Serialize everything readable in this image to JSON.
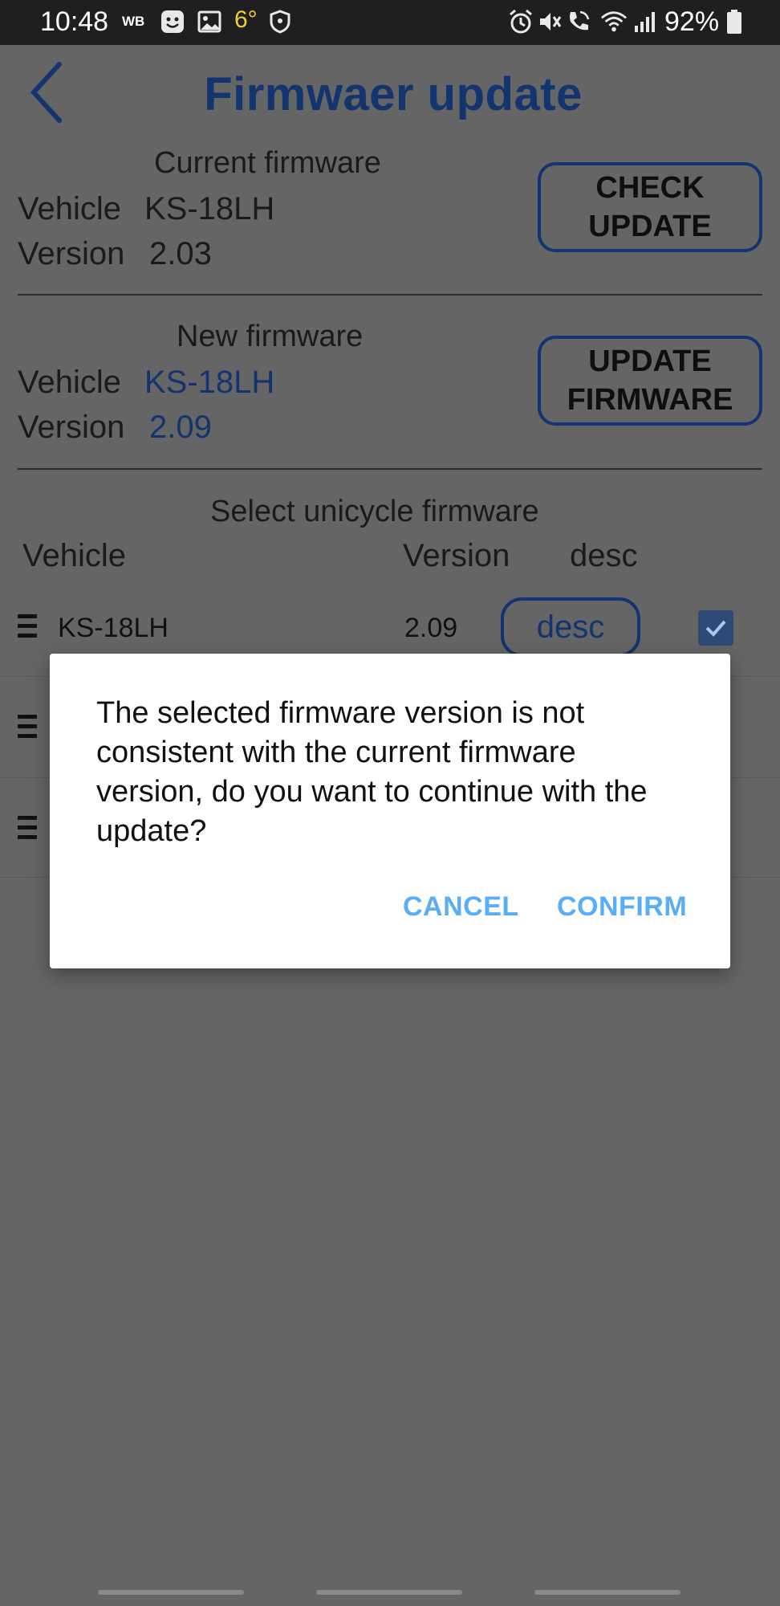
{
  "status_bar": {
    "time": "10:48",
    "carrier_badge": "WB",
    "temperature": "6°",
    "battery_percent": "92%",
    "icons": [
      "smiley-icon",
      "image-icon",
      "shield-icon",
      "alarm-icon",
      "mute-icon",
      "wifi-call-icon",
      "wifi-icon",
      "signal-icon",
      "battery-icon"
    ]
  },
  "header": {
    "title": "Firmwaer update",
    "back_icon": "chevron-left-icon"
  },
  "current_firmware": {
    "heading": "Current firmware",
    "vehicle_label": "Vehicle",
    "vehicle_value": "KS-18LH",
    "version_label": "Version",
    "version_value": "2.03",
    "button_line1": "CHECK",
    "button_line2": "UPDATE"
  },
  "new_firmware": {
    "heading": "New firmware",
    "vehicle_label": "Vehicle",
    "vehicle_value": "KS-18LH",
    "version_label": "Version",
    "version_value": "2.09",
    "button_line1": "UPDATE",
    "button_line2": "FIRMWARE"
  },
  "select_section": {
    "heading": "Select unicycle firmware",
    "columns": [
      "Vehicle",
      "Version",
      "desc"
    ],
    "rows": [
      {
        "vehicle": "KS-18LH",
        "version": "2.09",
        "desc_label": "desc",
        "checked": true
      }
    ]
  },
  "dialog": {
    "message": "The selected firmware version is not consistent with the current firmware version, do you want to continue with the update?",
    "cancel_label": "CANCEL",
    "confirm_label": "CONFIRM"
  },
  "colors": {
    "scrim_background": "#656565",
    "accent_blue": "#13346e",
    "dialog_button": "#59aef6"
  }
}
